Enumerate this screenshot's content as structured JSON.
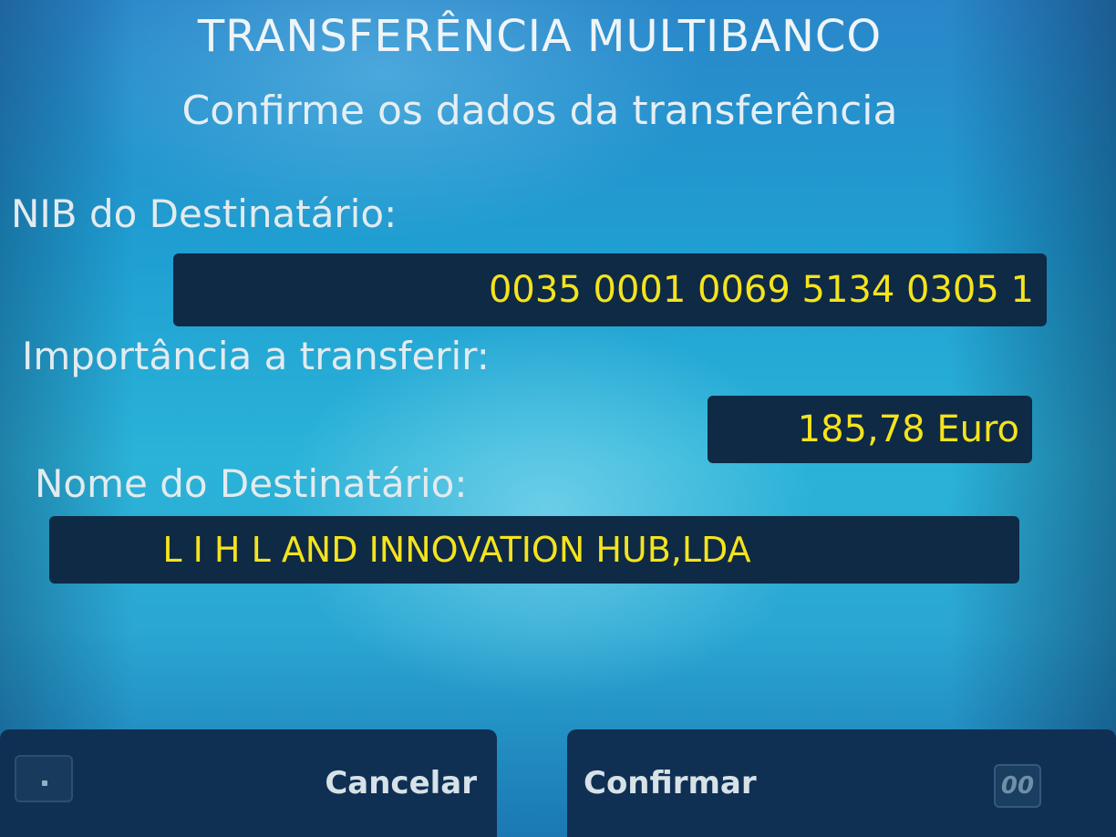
{
  "screen": {
    "title": "TRANSFERÊNCIA MULTIBANCO",
    "subtitle": "Confirme os dados da transferência"
  },
  "fields": {
    "nib_label": "NIB do Destinatário:",
    "nib_value": "0035 0001 0069 5134 0305 1",
    "amount_label": "Importância a transferir:",
    "amount_value": "185,78 Euro",
    "name_label": "Nome do Destinatário:",
    "name_value": "L I H L AND INNOVATION HUB,LDA"
  },
  "buttons": {
    "cancel_label": "Cancelar",
    "confirm_label": "Confirmar"
  },
  "timer": {
    "value": "00"
  },
  "colors": {
    "screen_background": "#2bb3d8",
    "value_box": "#0e2a45",
    "value_text": "#f5e31d",
    "label_text": "#e2ebef",
    "softkey": "#0f3052"
  }
}
